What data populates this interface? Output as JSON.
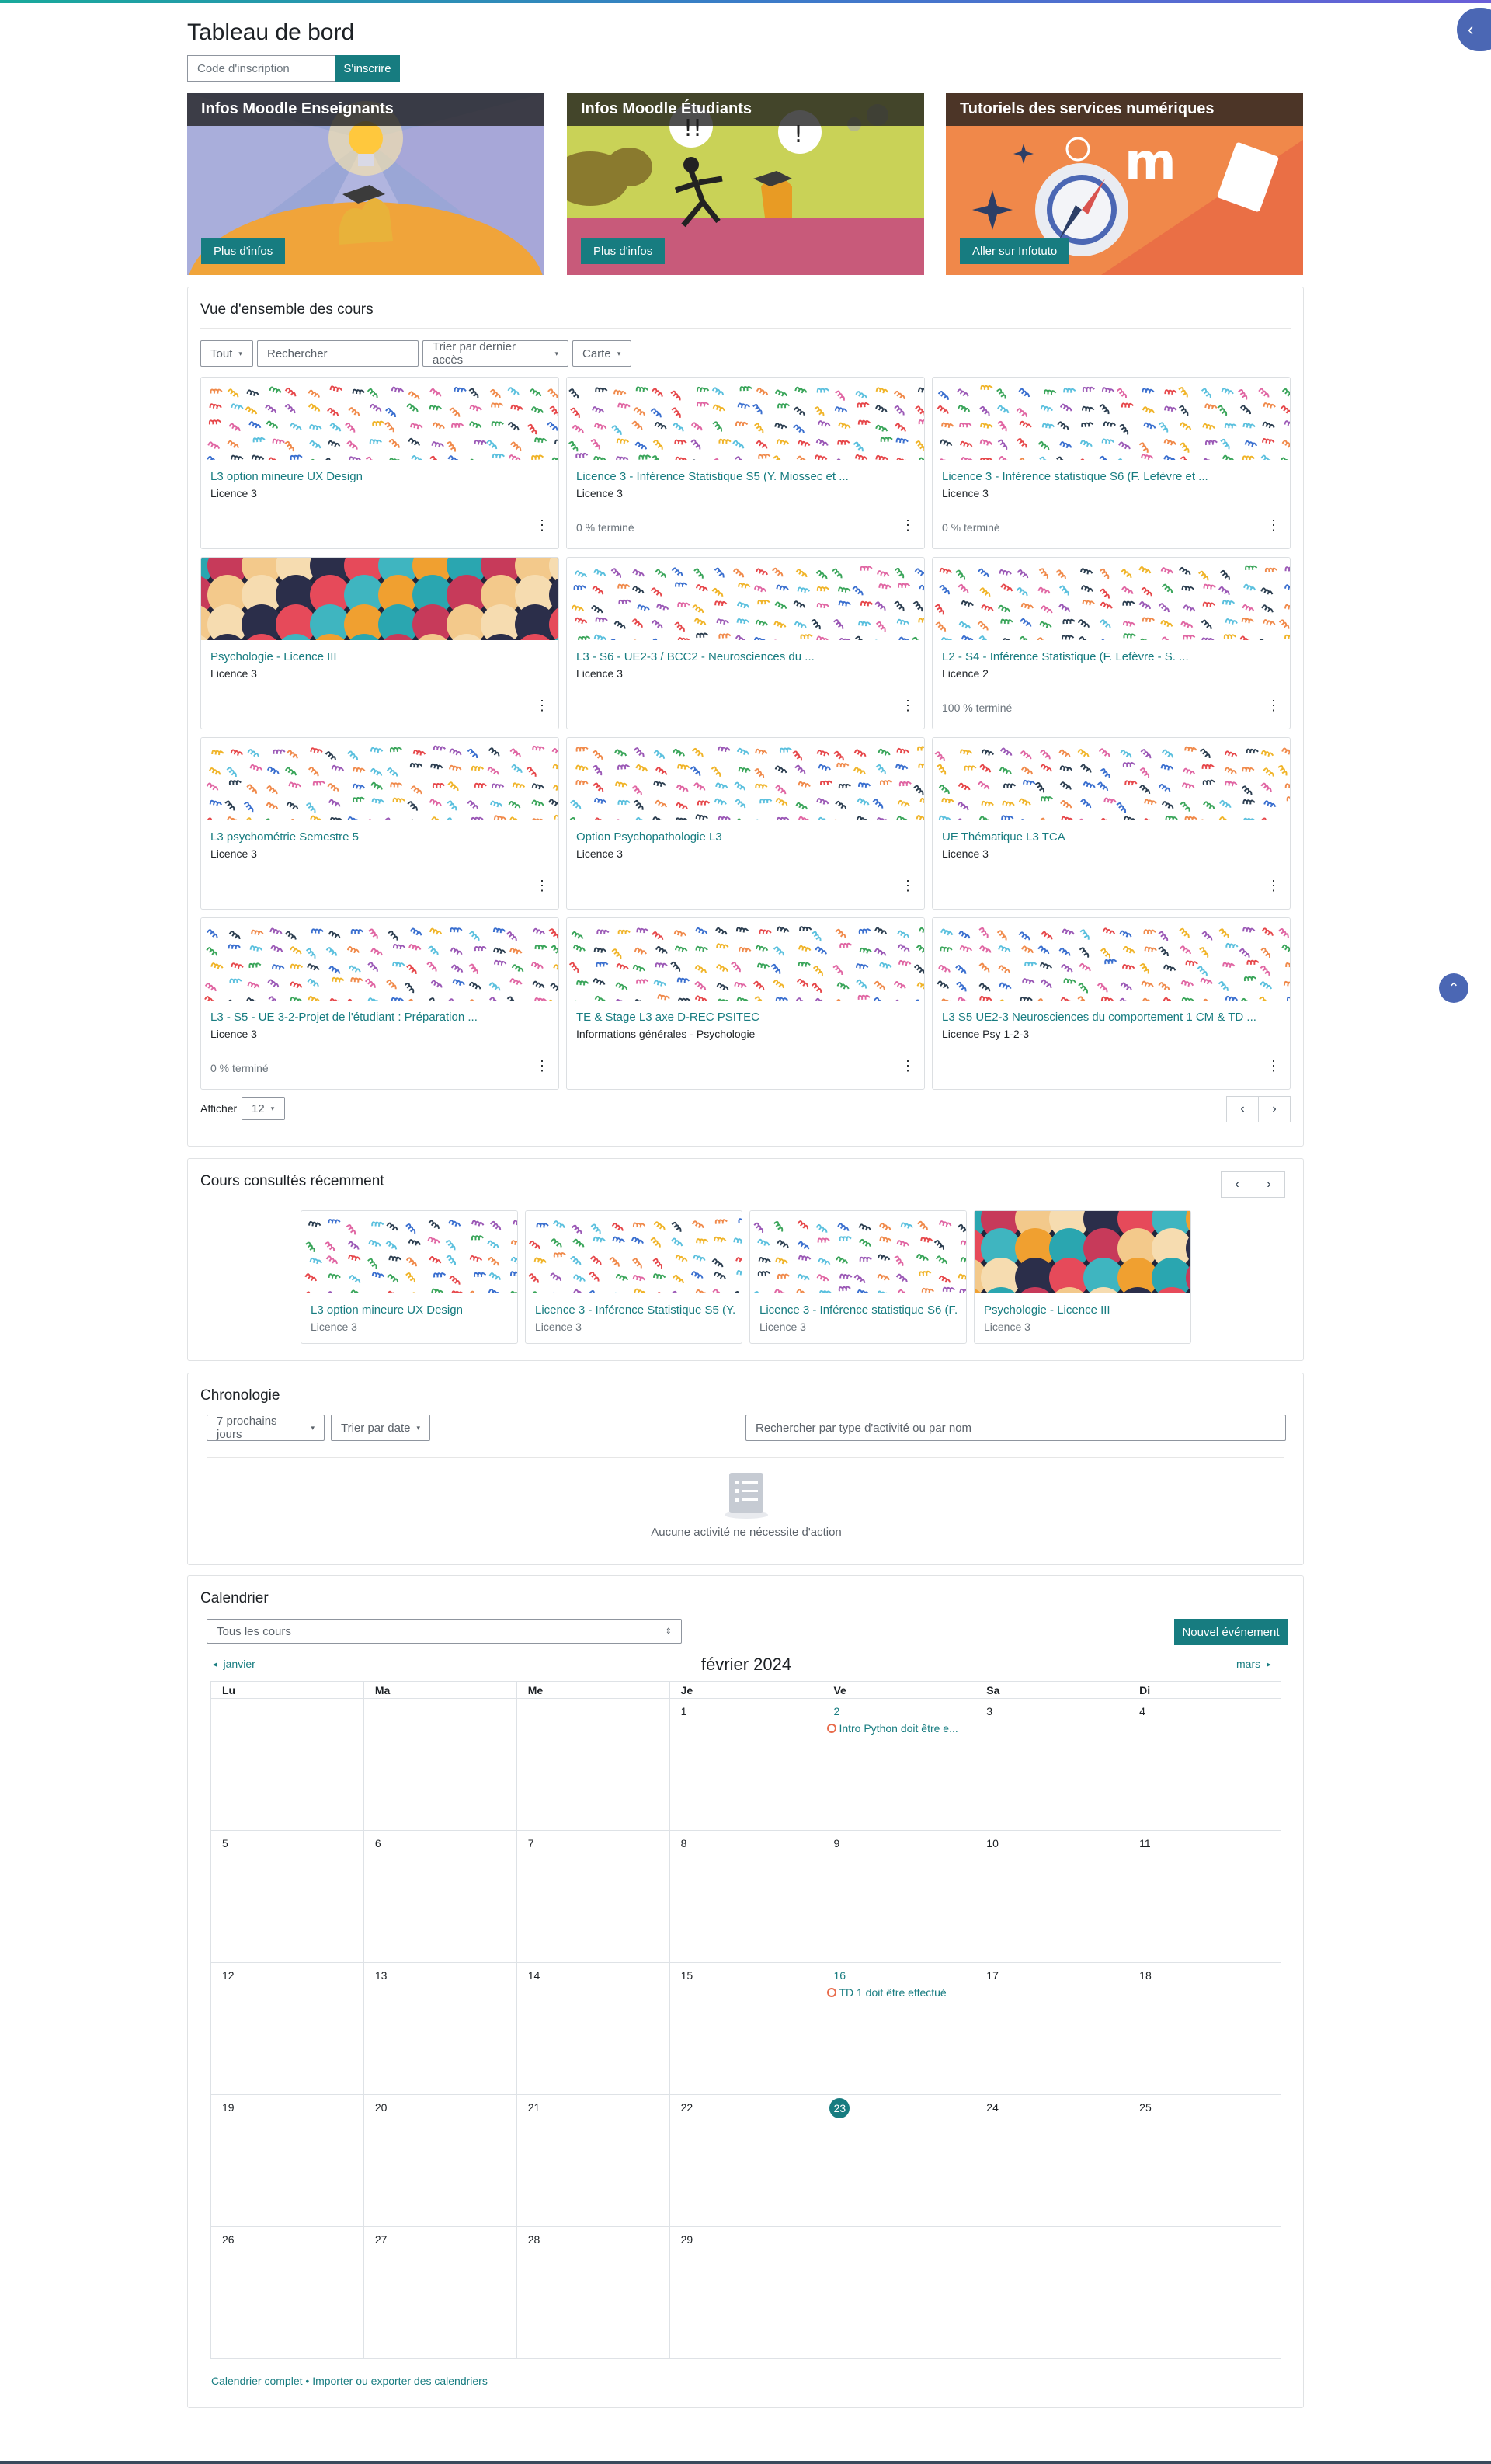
{
  "page": {
    "title": "Tableau de bord"
  },
  "enroll": {
    "placeholder": "Code d'inscription",
    "button": "S'inscrire"
  },
  "banners": [
    {
      "title": "Infos Moodle Enseignants",
      "button": "Plus d'infos"
    },
    {
      "title": "Infos Moodle Étudiants",
      "button": "Plus d'infos"
    },
    {
      "title": "Tutoriels des services numériques",
      "button": "Aller sur Infotuto"
    }
  ],
  "overview": {
    "title": "Vue d'ensemble des cours",
    "filter": "Tout",
    "search_placeholder": "Rechercher",
    "sort": "Trier par dernier accès",
    "view": "Carte",
    "show_label": "Afficher",
    "show_value": "12",
    "courses": [
      {
        "name": "L3 option mineure UX Design",
        "category": "Licence 3",
        "progress": "",
        "image": "pattern"
      },
      {
        "name": "Licence 3 - Inférence Statistique S5 (Y. Miossec et ...",
        "category": "Licence 3",
        "progress": "0 % terminé",
        "image": "pattern"
      },
      {
        "name": "Licence 3 - Inférence statistique S6 (F. Lefèvre et ...",
        "category": "Licence 3",
        "progress": "0 % terminé",
        "image": "pattern"
      },
      {
        "name": "Psychologie - Licence III",
        "category": "Licence 3",
        "progress": "",
        "image": "heads"
      },
      {
        "name": "L3 - S6 - UE2-3 / BCC2 - Neurosciences du ...",
        "category": "Licence 3",
        "progress": "",
        "image": "pattern"
      },
      {
        "name": "L2 - S4 - Inférence Statistique (F. Lefèvre - S. ...",
        "category": "Licence 2",
        "progress": "100 % terminé",
        "image": "pattern"
      },
      {
        "name": "L3 psychométrie Semestre 5",
        "category": "Licence 3",
        "progress": "",
        "image": "pattern"
      },
      {
        "name": "Option Psychopathologie L3",
        "category": "Licence 3",
        "progress": "",
        "image": "pattern"
      },
      {
        "name": "UE Thématique L3 TCA",
        "category": "Licence 3",
        "progress": "",
        "image": "pattern"
      },
      {
        "name": "L3 - S5 - UE 3-2-Projet de l'étudiant : Préparation ...",
        "category": "Licence 3",
        "progress": "0 % terminé",
        "image": "pattern"
      },
      {
        "name": "TE & Stage L3 axe D-REC PSITEC",
        "category": "Informations générales - Psychologie",
        "progress": "",
        "image": "pattern"
      },
      {
        "name": "L3 S5 UE2-3 Neurosciences du comportement 1 CM & TD ...",
        "category": "Licence Psy 1-2-3",
        "progress": "",
        "image": "pattern"
      }
    ]
  },
  "recent": {
    "title": "Cours consultés récemment",
    "courses": [
      {
        "name": "L3 option mineure UX Design",
        "category": "Licence 3",
        "image": "pattern"
      },
      {
        "name": "Licence 3 - Inférence Statistique S5 (Y. ...",
        "category": "Licence 3",
        "image": "pattern"
      },
      {
        "name": "Licence 3 - Inférence statistique S6 (F. ...",
        "category": "Licence 3",
        "image": "pattern"
      },
      {
        "name": "Psychologie - Licence III",
        "category": "Licence 3",
        "image": "heads"
      }
    ]
  },
  "timeline": {
    "title": "Chronologie",
    "range": "7 prochains jours",
    "sort": "Trier par date",
    "search_placeholder": "Rechercher par type d'activité ou par nom",
    "empty": "Aucune activité ne nécessite d'action"
  },
  "calendar": {
    "title": "Calendrier",
    "course_filter": "Tous les cours",
    "new_event": "Nouvel événement",
    "prev": "janvier",
    "month": "février 2024",
    "next": "mars",
    "weekdays": [
      "Lu",
      "Ma",
      "Me",
      "Je",
      "Ve",
      "Sa",
      "Di"
    ],
    "weeks": [
      [
        "",
        "",
        "",
        "1",
        "2",
        "3",
        "4"
      ],
      [
        "5",
        "6",
        "7",
        "8",
        "9",
        "10",
        "11"
      ],
      [
        "12",
        "13",
        "14",
        "15",
        "16",
        "17",
        "18"
      ],
      [
        "19",
        "20",
        "21",
        "22",
        "23",
        "24",
        "25"
      ],
      [
        "26",
        "27",
        "28",
        "29",
        "",
        "",
        ""
      ]
    ],
    "today": "23",
    "events": [
      {
        "day": "2",
        "label": "Intro Python doit être e..."
      },
      {
        "day": "16",
        "label": "TD 1 doit être effectué"
      }
    ],
    "footer_full": "Calendrier complet",
    "footer_sep": " • ",
    "footer_import": "Importer ou exporter des calendriers"
  },
  "colors": {
    "accent": "#177c80",
    "brand": "#4b67b4",
    "event": "#e86b4b"
  }
}
